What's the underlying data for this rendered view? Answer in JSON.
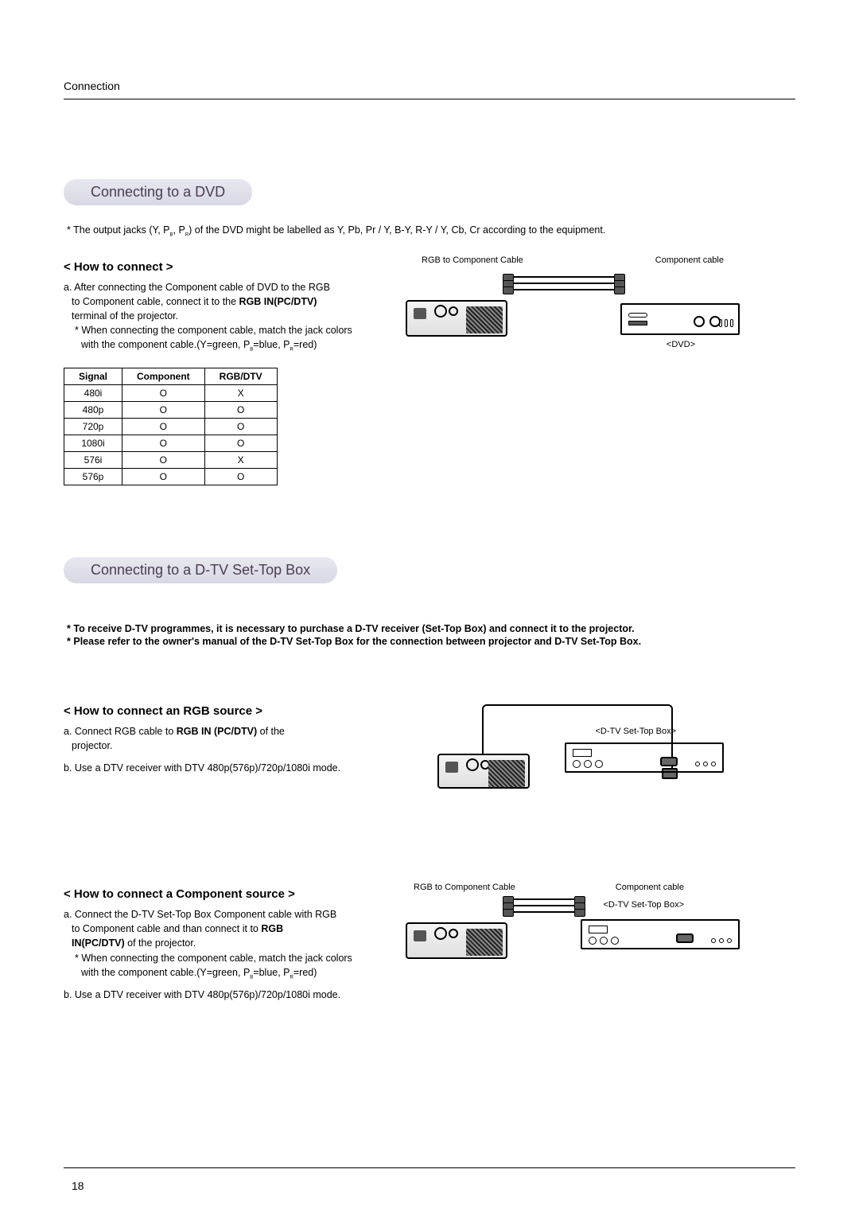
{
  "header": {
    "section": "Connection"
  },
  "footer": {
    "page": "18"
  },
  "s1": {
    "title": "Connecting to a DVD",
    "noteStar": "*",
    "note_a": "The output jacks (Y, P",
    "note_b": "B",
    "note_c": ", P",
    "note_d": "R",
    "note_e": ") of the DVD might be labelled as Y, Pb, Pr / Y, B-Y, R-Y / Y, Cb, Cr according to the equipment.",
    "howto": "< How to connect >",
    "step_a1": "a. After connecting the Component cable of DVD to the RGB",
    "step_a2": "to Component cable, connect it to the ",
    "step_a2b": "RGB IN(PC/DTV)",
    "step_a3": "terminal of the projector.",
    "step_star1": "* When connecting the component cable, match the jack colors",
    "step_star2a": "with the component cable.(Y=green, P",
    "step_star2b": "B",
    "step_star2c": "=blue, P",
    "step_star2d": "R",
    "step_star2e": "=red)",
    "diag": {
      "rgbCable": "RGB to Component Cable",
      "compCable": "Component cable",
      "dvd": "<DVD>"
    },
    "table": {
      "h1": "Signal",
      "h2": "Component",
      "h3": "RGB/DTV",
      "rows": [
        [
          "480i",
          "O",
          "X"
        ],
        [
          "480p",
          "O",
          "O"
        ],
        [
          "720p",
          "O",
          "O"
        ],
        [
          "1080i",
          "O",
          "O"
        ],
        [
          "576i",
          "O",
          "X"
        ],
        [
          "576p",
          "O",
          "O"
        ]
      ]
    }
  },
  "s2": {
    "title": "Connecting to a D-TV Set-Top Box",
    "bullet1s": "*",
    "bullet1": "To receive D-TV programmes, it is necessary to purchase a D-TV receiver (Set-Top Box) and connect it to the projector.",
    "bullet2s": "*",
    "bullet2": "Please refer to the owner's manual of the D-TV Set-Top Box for the connection between projector and D-TV Set-Top Box.",
    "rgb": {
      "head": "< How to connect an RGB source >",
      "a1": "a. Connect RGB cable to ",
      "a1b": "RGB IN (PC/DTV)",
      "a1c": " of the",
      "a2": "projector.",
      "b": "b. Use a DTV receiver with DTV 480p(576p)/720p/1080i mode.",
      "diag_label": "<D-TV Set-Top Box>"
    },
    "comp": {
      "head": "< How to connect a Component source >",
      "a1": "a. Connect the D-TV Set-Top Box Component cable with RGB",
      "a2": "to Component cable and than connect it to ",
      "a2b": "RGB",
      "a3b": "IN(PC/DTV)",
      "a3": " of the projector.",
      "star1": "* When connecting the component cable, match the jack colors",
      "star2a": "with the component cable.(Y=green, P",
      "star2b": "B",
      "star2c": "=blue, P",
      "star2d": "R",
      "star2e": "=red)",
      "b": "b. Use a DTV receiver with DTV 480p(576p)/720p/1080i mode.",
      "diag": {
        "rgbCable": "RGB to Component Cable",
        "compCable": "Component cable",
        "settop": "<D-TV Set-Top Box>"
      }
    }
  }
}
